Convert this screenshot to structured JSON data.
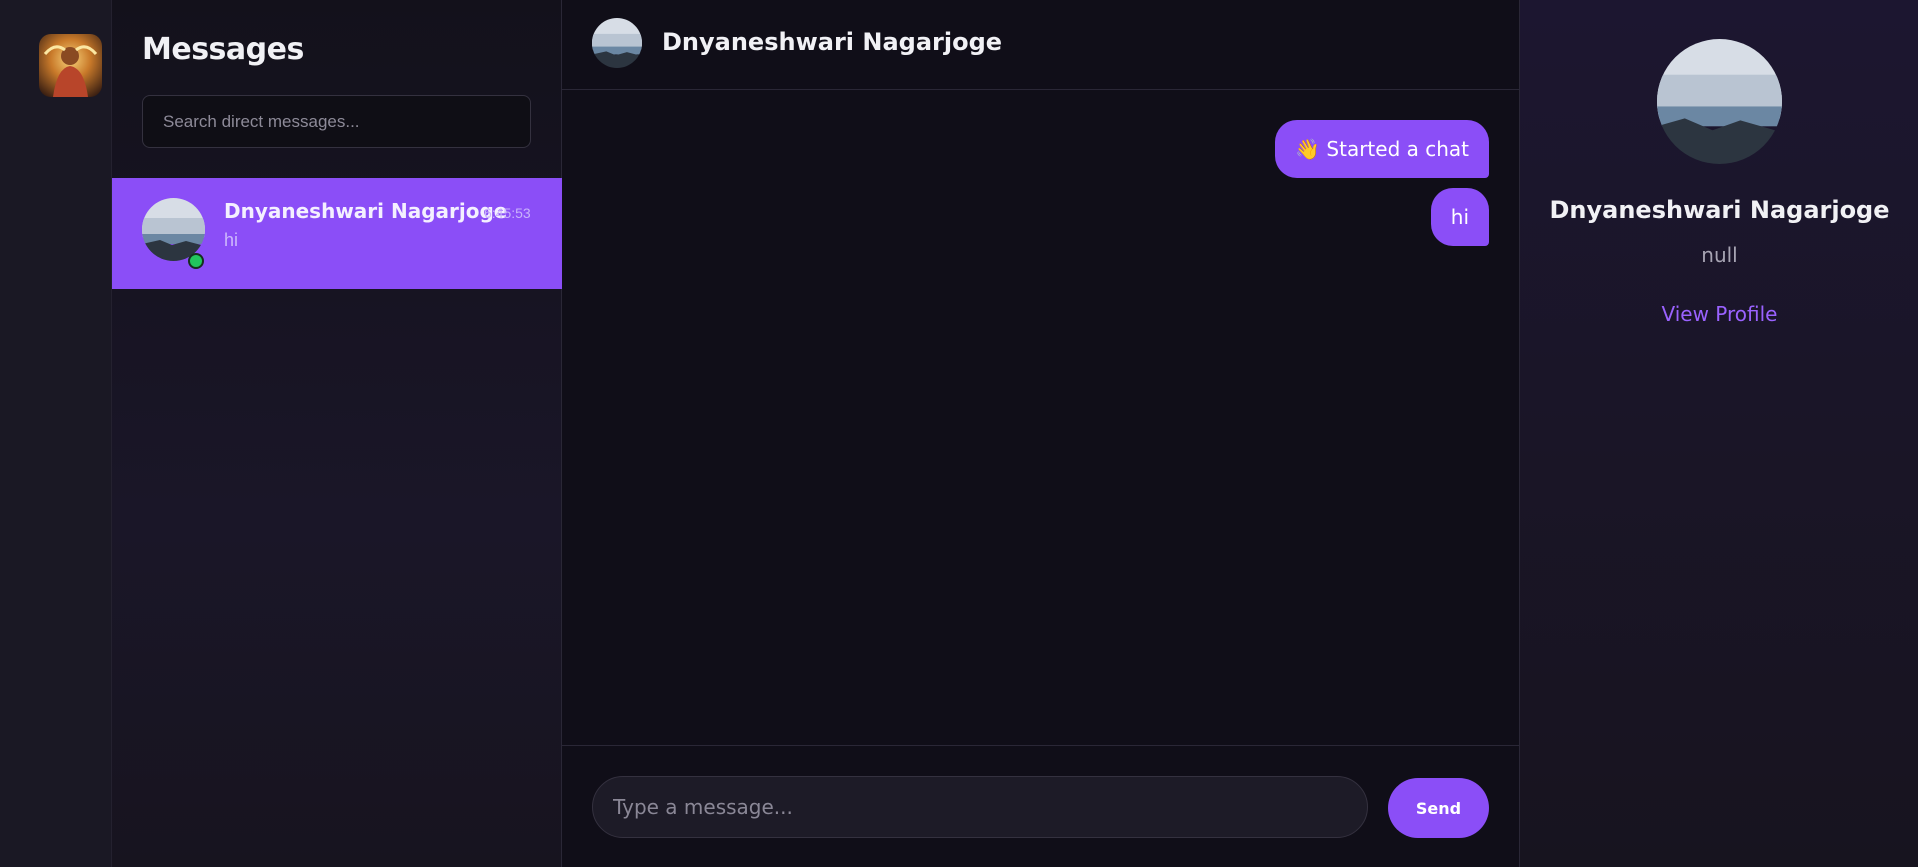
{
  "rail": {
    "user_avatar_icon": "user-avatar-icon"
  },
  "conversations": {
    "title": "Messages",
    "search_placeholder": "Search direct messages...",
    "items": [
      {
        "name": "Dnyaneshwari Nagarjoge",
        "time": "6:45:53",
        "preview": "hi",
        "online": true,
        "active": true
      }
    ]
  },
  "chat": {
    "header_name": "Dnyaneshwari Nagarjoge",
    "messages": [
      {
        "text": "👋 Started a chat",
        "sent": true
      },
      {
        "text": "hi",
        "sent": true
      }
    ],
    "input_placeholder": "Type a message...",
    "send_label": "Send"
  },
  "profile": {
    "name": "Dnyaneshwari Nagarjoge",
    "subtitle": "null",
    "view_profile_label": "View Profile"
  },
  "colors": {
    "accent": "#8b4ef7",
    "online": "#22c55e",
    "link": "#9a62ff",
    "background": "#100e18"
  }
}
